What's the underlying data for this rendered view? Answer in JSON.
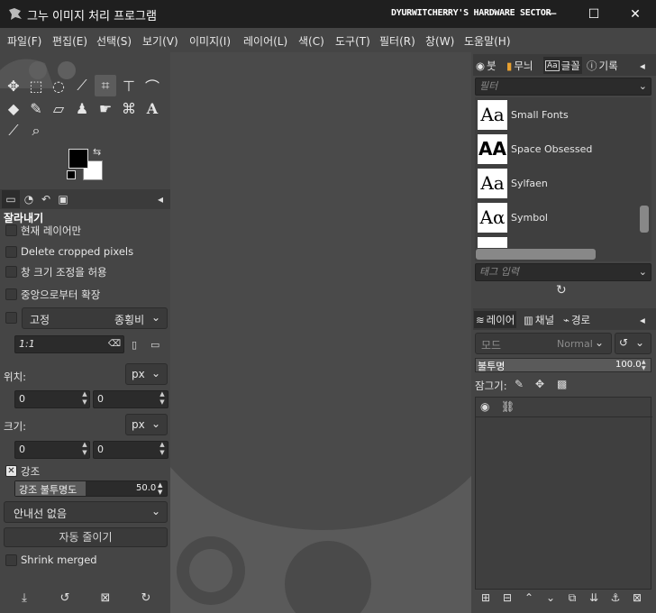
{
  "window": {
    "title": "그누 이미지 처리 프로그램",
    "watermark": "DYURWITCHERRY'S HARDWARE SECTOR",
    "controls": {
      "minimize": "─",
      "maximize": "☐",
      "close": "✕"
    }
  },
  "menu": [
    "파일(F)",
    "편집(E)",
    "선택(S)",
    "보기(V)",
    "이미지(I)",
    "레이어(L)",
    "색(C)",
    "도구(T)",
    "필터(R)",
    "창(W)",
    "도움말(H)"
  ],
  "tool_options": {
    "title": "잘라내기",
    "current_layer_only": "현재 레이어만",
    "delete_cropped": "Delete cropped pixels",
    "allow_growing": "창 크기 조정을 허용",
    "expand_center": "중앙으로부터 확장",
    "fixed_label": "고정",
    "fixed_value": "종횡비",
    "ratio_value": "1:1",
    "position_label": "위치:",
    "position_unit": "px",
    "position_x": "0",
    "position_y": "0",
    "size_label": "크기:",
    "size_unit": "px",
    "size_w": "0",
    "size_h": "0",
    "highlight_label": "강조",
    "highlight_opacity_label": "강조 불투명도",
    "highlight_opacity_value": "50.0",
    "guides_value": "안내선 없음",
    "auto_shrink": "자동 줄이기",
    "shrink_merged": "Shrink merged"
  },
  "top_dock": {
    "tabs": [
      {
        "icon": "brush-icon",
        "label": "붓"
      },
      {
        "icon": "pattern-icon",
        "label": "무늬"
      },
      {
        "icon": "font-icon",
        "label": "글꼴"
      },
      {
        "icon": "help-icon",
        "label": "기록"
      }
    ],
    "filter_placeholder": "필터",
    "fonts": [
      {
        "preview": "Aa",
        "name": "Small Fonts"
      },
      {
        "preview": "AA",
        "name": "Space Obsessed"
      },
      {
        "preview": "Aa",
        "name": "Sylfaen"
      },
      {
        "preview": "Aα",
        "name": "Symbol"
      }
    ],
    "tag_placeholder": "태그 입력"
  },
  "layers_dock": {
    "tabs": [
      {
        "label": "레이어"
      },
      {
        "label": "채널"
      },
      {
        "label": "경로"
      }
    ],
    "mode_label": "모드",
    "mode_value": "Normal",
    "opacity_label": "불투명",
    "opacity_value": "100.0",
    "lock_label": "잠그기:"
  },
  "colors": {
    "titlebar": "#1f1f1f",
    "panel": "#454545",
    "canvas": "#4a4a4a",
    "logo": "#5a5a5a"
  }
}
